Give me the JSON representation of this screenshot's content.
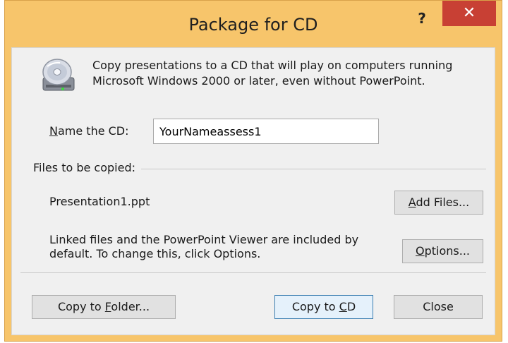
{
  "window": {
    "title": "Package for CD",
    "help_label": "?",
    "close_label": "✕"
  },
  "intro_text": "Copy presentations to a CD that will play on computers running Microsoft Windows 2000 or later, even without PowerPoint.",
  "name_field": {
    "label_mnemonic": "N",
    "label_rest": "ame the CD:",
    "value": "YourNameassess1"
  },
  "files": {
    "heading": "Files to be copied:",
    "items": [
      "Presentation1.ppt"
    ],
    "note": "Linked files and the PowerPoint Viewer are included by default. To change this, click Options."
  },
  "buttons": {
    "add_files": {
      "mnemonic": "A",
      "rest": "dd Files..."
    },
    "options": {
      "mnemonic": "O",
      "rest": "ptions..."
    },
    "copy_to_folder": {
      "before": "Copy to ",
      "mnemonic": "F",
      "rest": "older..."
    },
    "copy_to_cd": {
      "before": "Copy to ",
      "mnemonic": "C",
      "rest": "D"
    },
    "close": "Close"
  },
  "colors": {
    "title_bar": "#f7c56b",
    "close_button": "#c84034",
    "dialog_bg": "#f0f0f0"
  },
  "icons": {
    "cd": "cd-drive-icon"
  }
}
